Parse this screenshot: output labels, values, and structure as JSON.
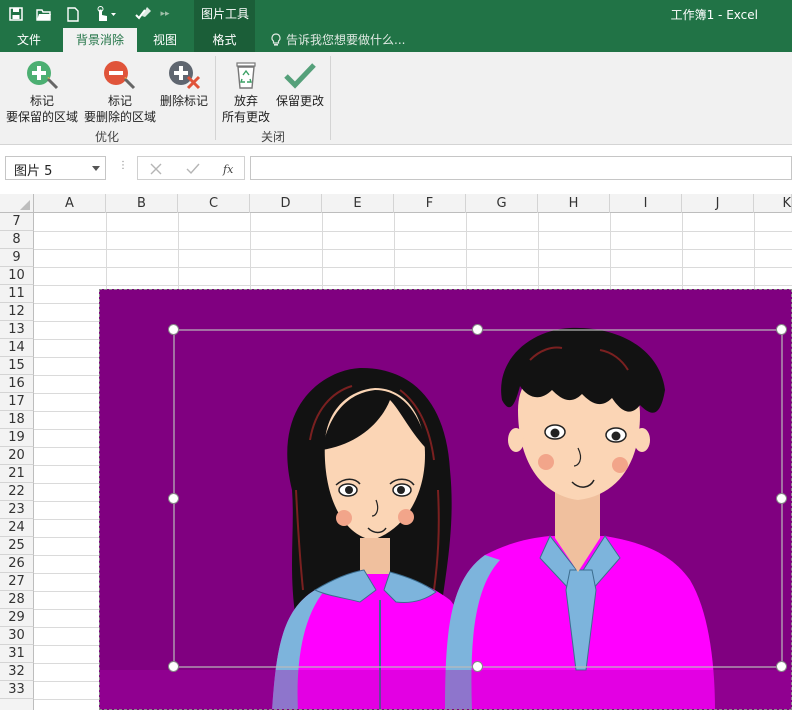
{
  "titlebar": {
    "context_group": "图片工具",
    "window_title": "工作簿1 - Excel"
  },
  "tabs": {
    "file": "文件",
    "background_removal": "背景消除",
    "view": "视图",
    "format": "格式",
    "tell_me": "告诉我您想要做什么..."
  },
  "ribbon": {
    "mark_keep_line1": "标记",
    "mark_keep_line2": "要保留的区域",
    "mark_remove_line1": "标记",
    "mark_remove_line2": "要删除的区域",
    "delete_mark": "删除标记",
    "discard_line1": "放弃",
    "discard_line2": "所有更改",
    "keep_changes": "保留更改",
    "group_refine": "优化",
    "group_close": "关闭"
  },
  "formula_bar": {
    "name_box": "图片 5",
    "value": ""
  },
  "grid": {
    "columns": [
      "A",
      "B",
      "C",
      "D",
      "E",
      "F",
      "G",
      "H",
      "I",
      "J",
      "K"
    ],
    "rows": [
      "7",
      "8",
      "9",
      "10",
      "11",
      "12",
      "13",
      "14",
      "15",
      "16",
      "17",
      "18",
      "19",
      "20",
      "21",
      "22",
      "23",
      "24",
      "25",
      "26",
      "27",
      "28",
      "29",
      "30",
      "31",
      "32",
      "33"
    ]
  },
  "colors": {
    "excel_green": "#217346",
    "context_green": "#1b5e38",
    "removed_background": "#800080",
    "shirt_magenta": "#ff00ff",
    "collar_blue": "#7db4dc"
  },
  "icons": {
    "save": "save-icon",
    "open": "folder-open-icon",
    "new": "new-document-icon",
    "touch": "touch-mode-icon",
    "customize": "customize-quick-access-icon",
    "mark_keep": "add-mark-icon",
    "mark_remove": "remove-mark-icon",
    "delete_mark": "delete-mark-icon",
    "discard": "recycle-bin-icon",
    "keep": "checkmark-icon",
    "lightbulb": "lightbulb-icon"
  }
}
